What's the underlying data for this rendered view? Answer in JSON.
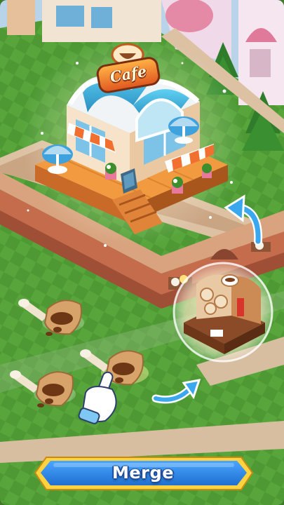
{
  "scene": {
    "building_sign": "Cafe",
    "merge_button_label": "Merge",
    "colors": {
      "grass": "#4f9a35",
      "path": "#d9b99a",
      "wall": "#c86a4a",
      "cafe_roof": "#35a9d6",
      "banner": "#2f7fd8",
      "banner_border": "#ffd23f"
    },
    "icons": [
      "coffee-bean-sack-icon",
      "coffee-machine-icon",
      "pointing-hand-icon",
      "upgrade-arrow-icon",
      "merge-arrow-icon"
    ]
  }
}
